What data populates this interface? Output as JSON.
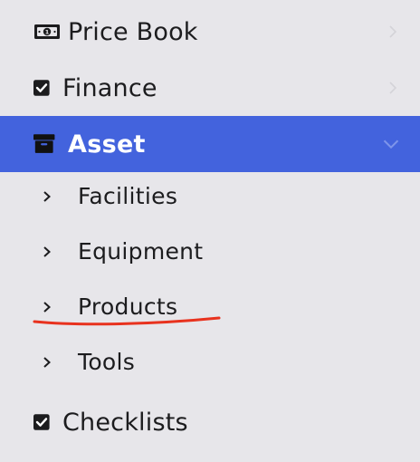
{
  "menu": {
    "items": [
      {
        "label": "Price Book",
        "icon": "money-bill-icon"
      },
      {
        "label": "Finance",
        "icon": "checkbox-icon"
      },
      {
        "label": "Asset",
        "icon": "archive-box-icon",
        "active": true
      },
      {
        "label": "Checklists",
        "icon": "checkbox-icon"
      }
    ],
    "submenu": [
      {
        "label": "Facilities"
      },
      {
        "label": "Equipment"
      },
      {
        "label": "Products"
      },
      {
        "label": "Tools"
      }
    ]
  },
  "colors": {
    "background": "#e7e6ea",
    "active_background": "#4363dd",
    "active_text": "#ffffff",
    "text": "#1c1c1e",
    "annotation": "#e8321e"
  }
}
